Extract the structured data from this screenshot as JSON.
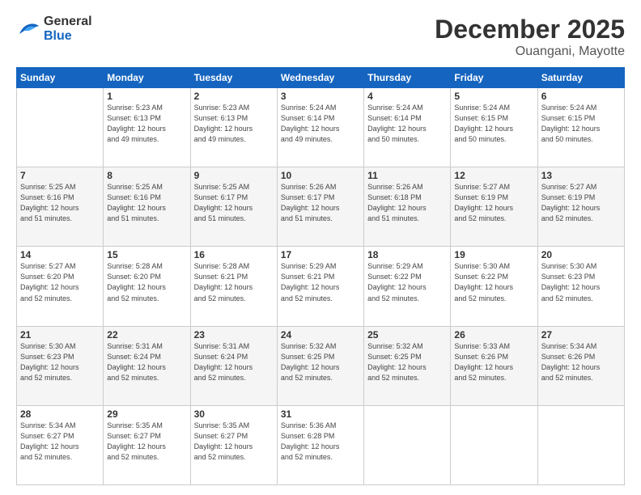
{
  "header": {
    "logo_line1": "General",
    "logo_line2": "Blue",
    "title": "December 2025",
    "subtitle": "Ouangani, Mayotte"
  },
  "calendar": {
    "days_of_week": [
      "Sunday",
      "Monday",
      "Tuesday",
      "Wednesday",
      "Thursday",
      "Friday",
      "Saturday"
    ],
    "weeks": [
      [
        {
          "day": "",
          "info": ""
        },
        {
          "day": "1",
          "info": "Sunrise: 5:23 AM\nSunset: 6:13 PM\nDaylight: 12 hours\nand 49 minutes."
        },
        {
          "day": "2",
          "info": "Sunrise: 5:23 AM\nSunset: 6:13 PM\nDaylight: 12 hours\nand 49 minutes."
        },
        {
          "day": "3",
          "info": "Sunrise: 5:24 AM\nSunset: 6:14 PM\nDaylight: 12 hours\nand 49 minutes."
        },
        {
          "day": "4",
          "info": "Sunrise: 5:24 AM\nSunset: 6:14 PM\nDaylight: 12 hours\nand 50 minutes."
        },
        {
          "day": "5",
          "info": "Sunrise: 5:24 AM\nSunset: 6:15 PM\nDaylight: 12 hours\nand 50 minutes."
        },
        {
          "day": "6",
          "info": "Sunrise: 5:24 AM\nSunset: 6:15 PM\nDaylight: 12 hours\nand 50 minutes."
        }
      ],
      [
        {
          "day": "7",
          "info": "Sunrise: 5:25 AM\nSunset: 6:16 PM\nDaylight: 12 hours\nand 51 minutes."
        },
        {
          "day": "8",
          "info": "Sunrise: 5:25 AM\nSunset: 6:16 PM\nDaylight: 12 hours\nand 51 minutes."
        },
        {
          "day": "9",
          "info": "Sunrise: 5:25 AM\nSunset: 6:17 PM\nDaylight: 12 hours\nand 51 minutes."
        },
        {
          "day": "10",
          "info": "Sunrise: 5:26 AM\nSunset: 6:17 PM\nDaylight: 12 hours\nand 51 minutes."
        },
        {
          "day": "11",
          "info": "Sunrise: 5:26 AM\nSunset: 6:18 PM\nDaylight: 12 hours\nand 51 minutes."
        },
        {
          "day": "12",
          "info": "Sunrise: 5:27 AM\nSunset: 6:19 PM\nDaylight: 12 hours\nand 52 minutes."
        },
        {
          "day": "13",
          "info": "Sunrise: 5:27 AM\nSunset: 6:19 PM\nDaylight: 12 hours\nand 52 minutes."
        }
      ],
      [
        {
          "day": "14",
          "info": "Sunrise: 5:27 AM\nSunset: 6:20 PM\nDaylight: 12 hours\nand 52 minutes."
        },
        {
          "day": "15",
          "info": "Sunrise: 5:28 AM\nSunset: 6:20 PM\nDaylight: 12 hours\nand 52 minutes."
        },
        {
          "day": "16",
          "info": "Sunrise: 5:28 AM\nSunset: 6:21 PM\nDaylight: 12 hours\nand 52 minutes."
        },
        {
          "day": "17",
          "info": "Sunrise: 5:29 AM\nSunset: 6:21 PM\nDaylight: 12 hours\nand 52 minutes."
        },
        {
          "day": "18",
          "info": "Sunrise: 5:29 AM\nSunset: 6:22 PM\nDaylight: 12 hours\nand 52 minutes."
        },
        {
          "day": "19",
          "info": "Sunrise: 5:30 AM\nSunset: 6:22 PM\nDaylight: 12 hours\nand 52 minutes."
        },
        {
          "day": "20",
          "info": "Sunrise: 5:30 AM\nSunset: 6:23 PM\nDaylight: 12 hours\nand 52 minutes."
        }
      ],
      [
        {
          "day": "21",
          "info": "Sunrise: 5:30 AM\nSunset: 6:23 PM\nDaylight: 12 hours\nand 52 minutes."
        },
        {
          "day": "22",
          "info": "Sunrise: 5:31 AM\nSunset: 6:24 PM\nDaylight: 12 hours\nand 52 minutes."
        },
        {
          "day": "23",
          "info": "Sunrise: 5:31 AM\nSunset: 6:24 PM\nDaylight: 12 hours\nand 52 minutes."
        },
        {
          "day": "24",
          "info": "Sunrise: 5:32 AM\nSunset: 6:25 PM\nDaylight: 12 hours\nand 52 minutes."
        },
        {
          "day": "25",
          "info": "Sunrise: 5:32 AM\nSunset: 6:25 PM\nDaylight: 12 hours\nand 52 minutes."
        },
        {
          "day": "26",
          "info": "Sunrise: 5:33 AM\nSunset: 6:26 PM\nDaylight: 12 hours\nand 52 minutes."
        },
        {
          "day": "27",
          "info": "Sunrise: 5:34 AM\nSunset: 6:26 PM\nDaylight: 12 hours\nand 52 minutes."
        }
      ],
      [
        {
          "day": "28",
          "info": "Sunrise: 5:34 AM\nSunset: 6:27 PM\nDaylight: 12 hours\nand 52 minutes."
        },
        {
          "day": "29",
          "info": "Sunrise: 5:35 AM\nSunset: 6:27 PM\nDaylight: 12 hours\nand 52 minutes."
        },
        {
          "day": "30",
          "info": "Sunrise: 5:35 AM\nSunset: 6:27 PM\nDaylight: 12 hours\nand 52 minutes."
        },
        {
          "day": "31",
          "info": "Sunrise: 5:36 AM\nSunset: 6:28 PM\nDaylight: 12 hours\nand 52 minutes."
        },
        {
          "day": "",
          "info": ""
        },
        {
          "day": "",
          "info": ""
        },
        {
          "day": "",
          "info": ""
        }
      ]
    ]
  }
}
